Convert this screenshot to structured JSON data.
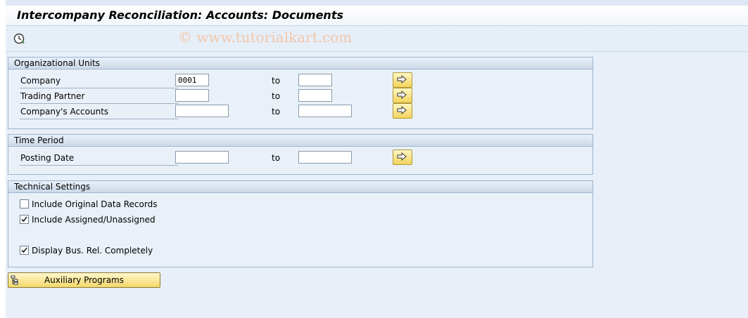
{
  "window": {
    "title": "Intercompany Reconciliation: Accounts: Documents",
    "watermark": "© www.tutorialkart.com"
  },
  "toolbar": {
    "execute_icon": "execute-clock-icon"
  },
  "org_units": {
    "header": "Organizational Units",
    "to_label": "to",
    "rows": [
      {
        "label": "Company",
        "from": "0001",
        "to": ""
      },
      {
        "label": "Trading Partner",
        "from": "",
        "to": ""
      },
      {
        "label": "Company's Accounts",
        "from": "",
        "to": ""
      }
    ]
  },
  "time_period": {
    "header": "Time Period",
    "to_label": "to",
    "rows": [
      {
        "label": "Posting Date",
        "from": "",
        "to": ""
      }
    ]
  },
  "technical": {
    "header": "Technical Settings",
    "options": [
      {
        "label": "Include Original Data Records",
        "checked": false
      },
      {
        "label": "Include Assigned/Unassigned",
        "checked": true
      },
      {
        "label": "Display Bus. Rel. Completely",
        "checked": true
      }
    ]
  },
  "aux_button": {
    "label": "Auxiliary Programs",
    "icon": "hierarchy-icon"
  },
  "colors": {
    "button_yellow": "#f3d45a",
    "group_border": "#9eb4cc",
    "background": "#e8eff8"
  }
}
